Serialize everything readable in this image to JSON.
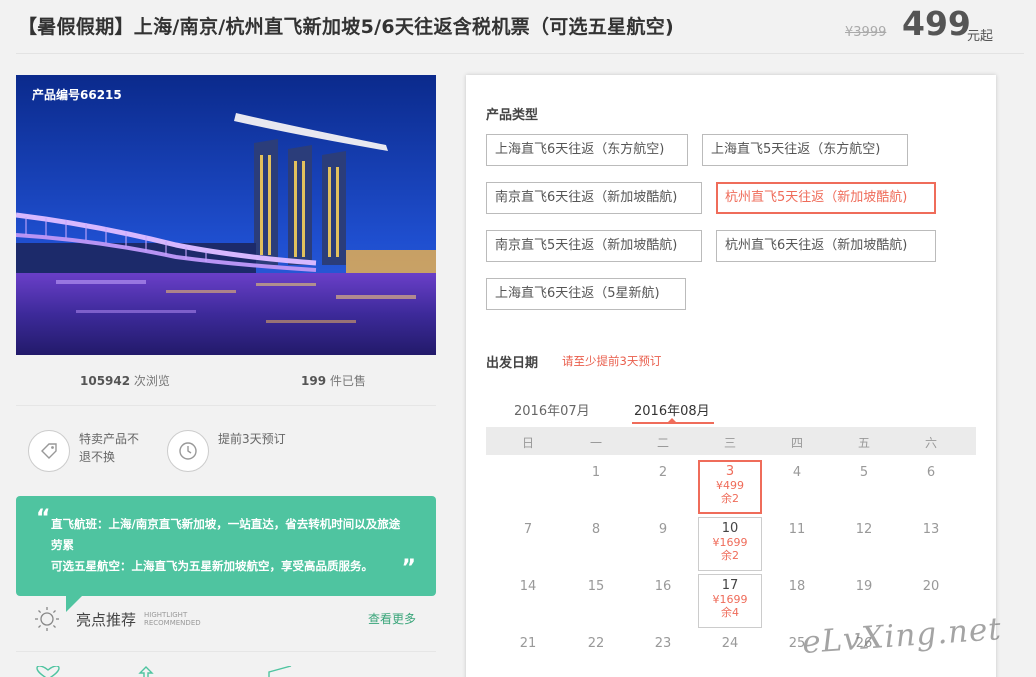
{
  "header": {
    "title": "【暑假假期】上海/南京/杭州直飞新加坡5/6天往返含税机票（可选五星航空)",
    "original_price": "¥3999",
    "price": "499",
    "price_unit": "元起"
  },
  "hero": {
    "product_no": "产品编号66215",
    "image_alt": "marina-bay-night"
  },
  "stats": {
    "views_num": "105942",
    "views_label": " 次浏览",
    "sold_num": "199",
    "sold_label": " 件已售"
  },
  "features": [
    {
      "icon": "tag-icon",
      "text": "特卖产品不退不换"
    },
    {
      "icon": "clock-icon",
      "text": "提前3天预订"
    }
  ],
  "quote": {
    "line1": "直飞航班：上海/南京直飞新加坡，一站直达，省去转机时间以及旅途劳累",
    "line2": "可选五星航空：上海直飞为五星新加坡航空，享受高品质服务。"
  },
  "highlight": {
    "title": "亮点推荐",
    "en_line1": "HIGHTLIGHT",
    "en_line2": "RECOMMENDED",
    "more": "查看更多"
  },
  "panel": {
    "type_label": "产品类型",
    "options": [
      "上海直飞6天往返（东方航空)",
      "上海直飞5天往返（东方航空)",
      "南京直飞6天往返（新加坡酷航)",
      "杭州直飞5天往返（新加坡酷航)",
      "南京直飞5天往返（新加坡酷航)",
      "杭州直飞6天往返（新加坡酷航)",
      "上海直飞6天往返（5星新航)"
    ],
    "selected_option_index": 3,
    "date_label": "出发日期",
    "date_note": "请至少提前3天预订",
    "months": [
      "2016年07月",
      "2016年08月"
    ],
    "active_month_index": 1,
    "weekdays": [
      "日",
      "一",
      "二",
      "三",
      "四",
      "五",
      "六"
    ],
    "weeks": [
      [
        "",
        "1",
        "2",
        "3",
        "4",
        "5",
        "6"
      ],
      [
        "7",
        "8",
        "9",
        "10",
        "11",
        "12",
        "13"
      ],
      [
        "14",
        "15",
        "16",
        "17",
        "18",
        "19",
        "20"
      ],
      [
        "21",
        "22",
        "23",
        "24",
        "25",
        "26",
        ""
      ]
    ],
    "available": [
      {
        "day": "3",
        "price": "¥499",
        "stock": "余2",
        "selected": true
      },
      {
        "day": "10",
        "price": "¥1699",
        "stock": "余2",
        "selected": false
      },
      {
        "day": "17",
        "price": "¥1699",
        "stock": "余4",
        "selected": false
      }
    ]
  },
  "watermark": "eLvXing.net",
  "colors": {
    "accent_red": "#ef6c5a",
    "quote_green": "#4fc4a0",
    "link_green": "#3aa57a"
  }
}
